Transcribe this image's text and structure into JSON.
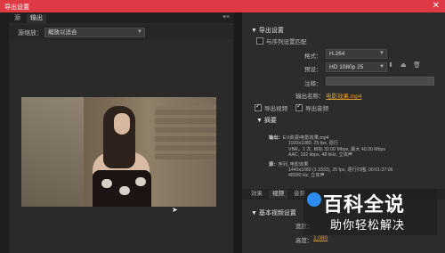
{
  "window": {
    "title": "导出设置",
    "close_glyph": "✕"
  },
  "left_tabs": {
    "source": "源",
    "output": "输出",
    "menu_glyph": "▾≡"
  },
  "source_scaling": {
    "label": "源缩放：",
    "value": "缩放以适合"
  },
  "export_settings": {
    "header": "导出设置",
    "match_sequence": "与序列设置匹配",
    "format_label": "格式：",
    "format_value": "H.264",
    "preset_label": "预设：",
    "preset_value": "HD 1080p 25",
    "comment_label": "注释：",
    "output_name_label": "输出名称：",
    "output_name_value": "电影效果.mp4",
    "export_video": "导出视频",
    "export_audio": "导出音频"
  },
  "summary": {
    "header": "摘要",
    "output_label": "输出：",
    "output_lines": [
      "E:\\\\资源\\电影效果.mp4",
      "1920x1080, 25 fps, 逐行",
      "VBR，1 次, 目标 32.00 Mbps, 最大 40.00 Mbps",
      "AAC, 192 kbps, 48 kHz, 立体声"
    ],
    "source_label": "源：",
    "source_lines": [
      "序列, 电影效果",
      "1440x1080 (1.3333), 25 fps, 逐行扫描, 00:01:37:06",
      "48000 Hz, 立体声"
    ]
  },
  "settings_tabs": [
    "效果",
    "视频",
    "音频"
  ],
  "basic_video": {
    "header": "基本视频设置",
    "width_label": "宽度：",
    "height_label": "高度：",
    "height_value": "1,080"
  },
  "watermark": {
    "big": "百科全说",
    "small": "助你轻松解决"
  },
  "colors": {
    "titlebar": "#de3a44",
    "accent": "#e0a030",
    "watermark_logo": "#2d8cf0"
  }
}
